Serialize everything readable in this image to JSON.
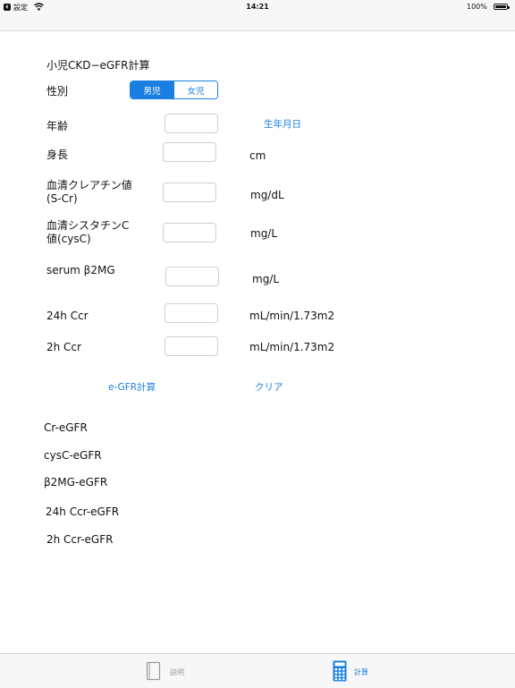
{
  "status_bar": {
    "back_label": "設定",
    "time": "14:21",
    "battery": "100%"
  },
  "title": "小児CKD−eGFR計算",
  "sex": {
    "label": "性別",
    "options": [
      "男児",
      "女児"
    ],
    "selected": "男児"
  },
  "fields": {
    "age": {
      "label": "年齢",
      "unit_link": "生年月日"
    },
    "height": {
      "label": "身長",
      "unit": "cm"
    },
    "scr": {
      "label_line1": "血清クレアチン値",
      "label_line2": "(S-Cr)",
      "unit": "mg/dL"
    },
    "cysc": {
      "label_line1": "血清シスタチンC",
      "label_line2": "値(cysC)",
      "unit": "mg/L"
    },
    "b2mg": {
      "label": "serum β2MG",
      "unit": "mg/L"
    },
    "ccr24": {
      "label": "24h Ccr",
      "unit": "mL/min/1.73m2"
    },
    "ccr2": {
      "label": "2h Ccr",
      "unit": "mL/min/1.73m2"
    }
  },
  "actions": {
    "calculate": "e-GFR計算",
    "clear": "クリア"
  },
  "results": {
    "cr_egfr": "Cr-eGFR",
    "cysc_egfr": "cysC-eGFR",
    "b2mg_egfr": "β2MG-eGFR",
    "ccr24_egfr": "24h Ccr-eGFR",
    "ccr2_egfr": "2h Ccr-eGFR"
  },
  "tab_bar": {
    "tabs": [
      {
        "label": "説明",
        "icon": "book-icon",
        "active": false
      },
      {
        "label": "計算",
        "icon": "calculator-icon",
        "active": true
      }
    ]
  },
  "colors": {
    "accent": "#1a7fe0",
    "inactive_tab": "#9a9a9a",
    "bar_background": "#f7f7f7"
  }
}
